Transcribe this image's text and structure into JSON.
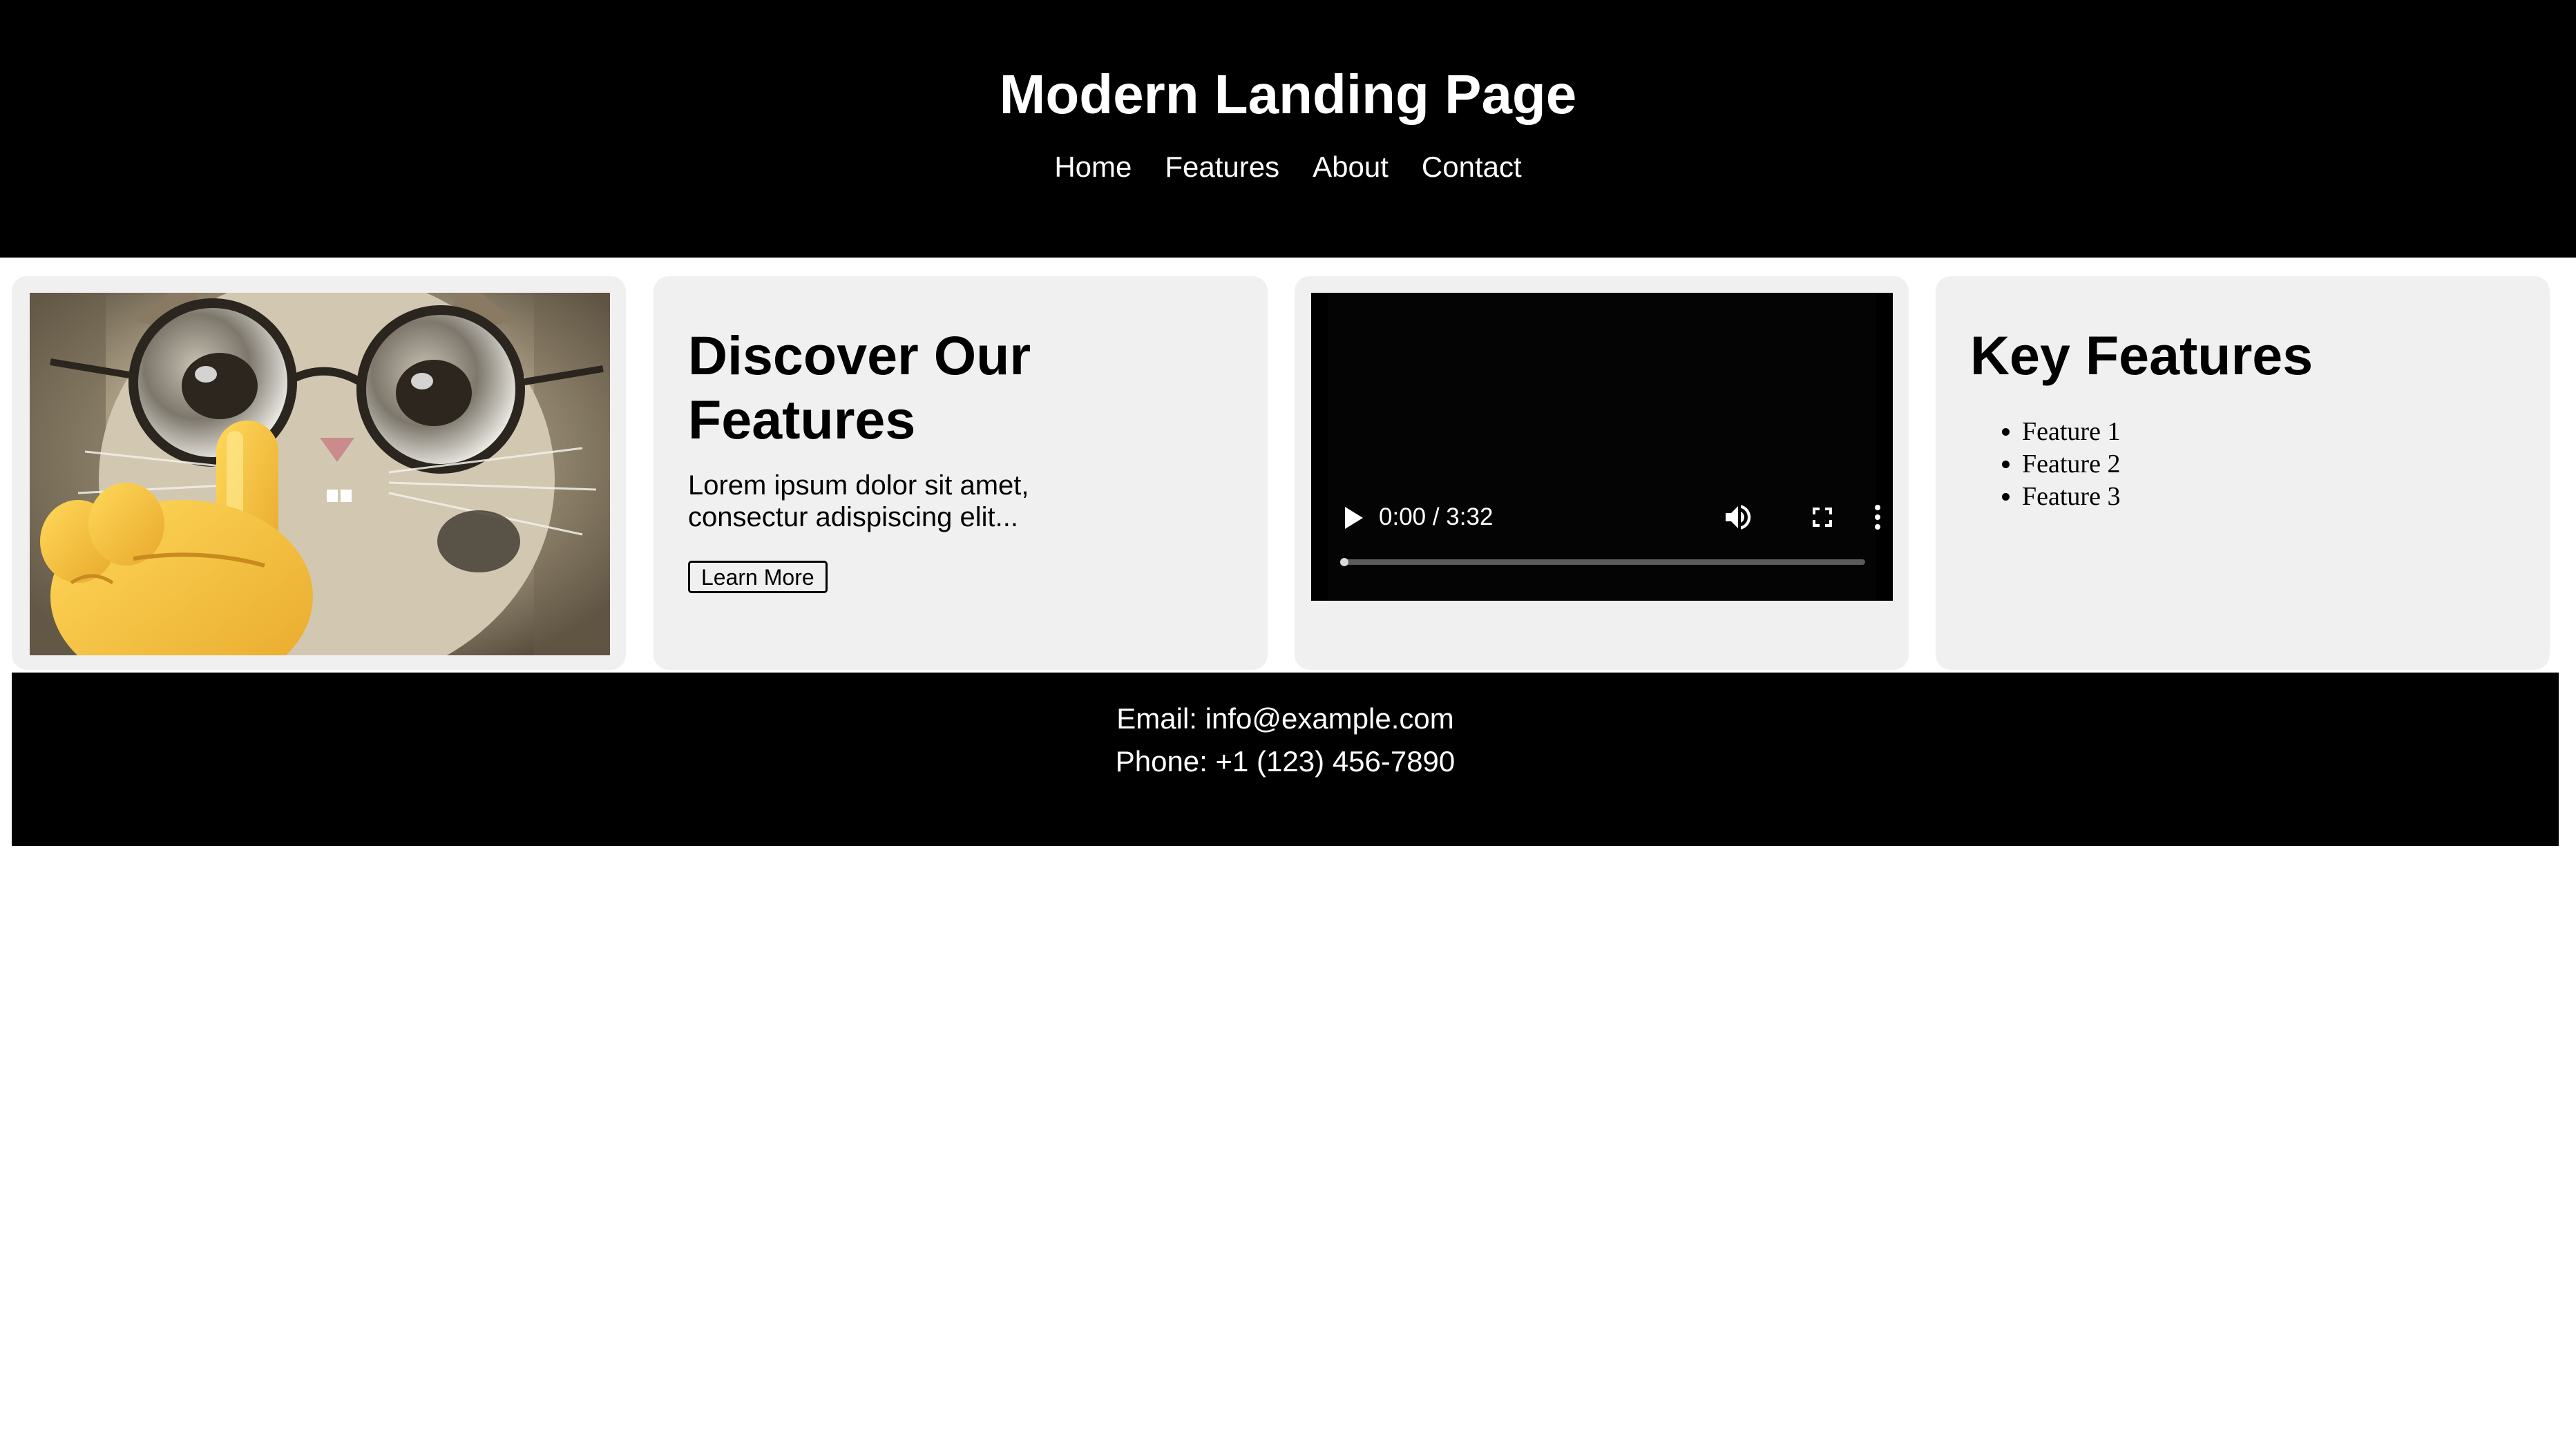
{
  "header": {
    "title": "Modern Landing Page",
    "nav": [
      "Home",
      "Features",
      "About",
      "Contact"
    ]
  },
  "intro": {
    "title": "Discover Our Features",
    "text": "Lorem ipsum dolor sit amet, consectur adispiscing elit...",
    "button_label": "Learn More"
  },
  "video": {
    "time": "0:00 / 3:32",
    "progress_fraction": 0
  },
  "features": {
    "title": "Key Features",
    "items": [
      "Feature 1",
      "Feature 2",
      "Feature 3"
    ]
  },
  "footer": {
    "email": "Email: info@example.com",
    "phone": "Phone: +1 (123) 456-7890"
  },
  "colors": {
    "header_bg": "#000000",
    "card_bg": "#f0f0f0",
    "footer_bg": "#000000",
    "text_light": "#ffffff"
  },
  "icons": {
    "image": "cat-with-glasses-image",
    "video_play": "play-icon",
    "video_volume": "volume-icon",
    "video_fullscreen": "fullscreen-icon",
    "video_more": "more-vert-icon"
  }
}
